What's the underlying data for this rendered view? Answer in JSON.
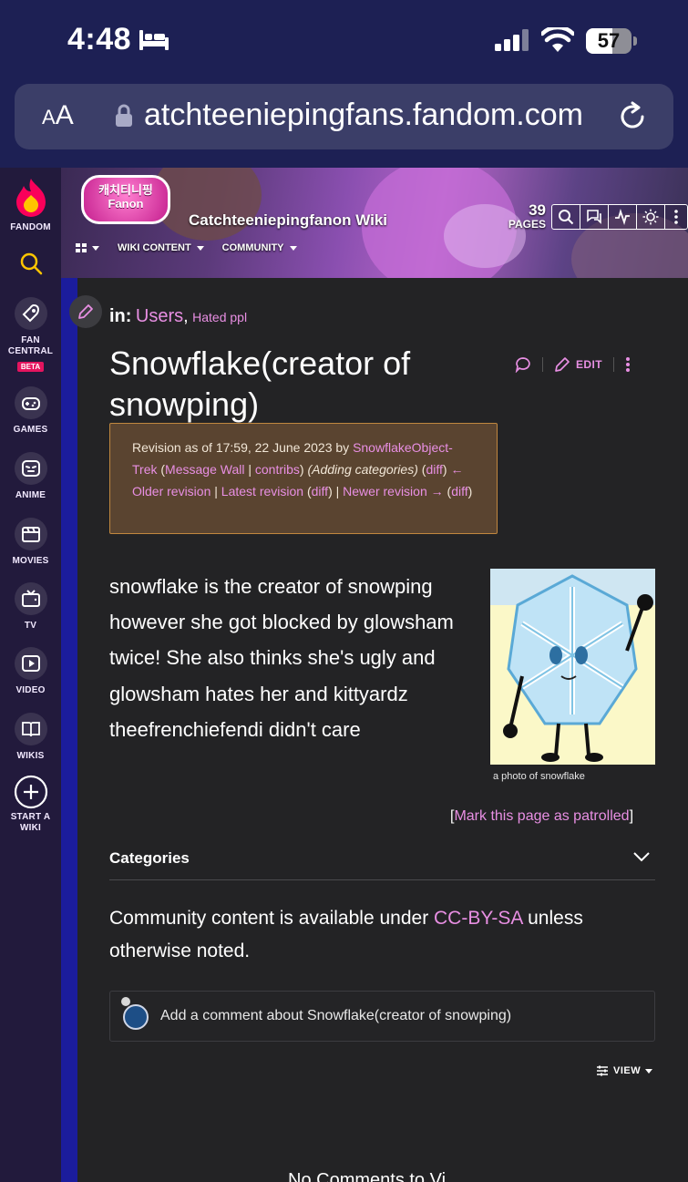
{
  "status_bar": {
    "time": "4:48",
    "battery": "57",
    "battery_level_percent": 57
  },
  "browser": {
    "aa_label_big": "A",
    "aa_label_small": "A",
    "url": "atchteeniepingfans.fandom.com"
  },
  "rail": {
    "logo_label": "FANDOM",
    "items": [
      {
        "label": "FAN CENTRAL",
        "badge": "BETA",
        "icon": "rocket-icon"
      },
      {
        "label": "GAMES",
        "icon": "gamepad-icon"
      },
      {
        "label": "ANIME",
        "icon": "anime-icon"
      },
      {
        "label": "MOVIES",
        "icon": "clapper-icon"
      },
      {
        "label": "TV",
        "icon": "tv-icon"
      },
      {
        "label": "VIDEO",
        "icon": "video-icon"
      },
      {
        "label": "WIKIS",
        "icon": "book-icon"
      },
      {
        "label": "START A WIKI",
        "icon": "plus-circle-icon"
      }
    ]
  },
  "wiki": {
    "logo_text": "캐치티니핑 Fanon",
    "name": "Catchteeniepingfanon Wiki",
    "pages_count": "39",
    "pages_label": "PAGES",
    "nav": [
      "WIKI CONTENT",
      "COMMUNITY"
    ]
  },
  "article": {
    "in_label": "in:",
    "categories": [
      "Users",
      "Hated ppl"
    ],
    "title": "Snowflake(creator of snowping)",
    "edit_label": "EDIT",
    "revision": {
      "prefix": "Revision as of 17:59, 22 June 2023 by ",
      "user": "SnowflakeObject-Trek",
      "message_wall": "Message Wall",
      "contribs": "contribs",
      "summary": "(Adding categories)",
      "diff": "diff",
      "older": "← Older revision",
      "latest": "Latest revision",
      "newer": "Newer revision →"
    },
    "body": "snowflake is the creator of snowping however she got blocked by glowsham twice! She also thinks she's ugly and glowsham hates her and kittyardz theefrenchiefendi didn't care",
    "image_caption": "a photo of snowflake",
    "patrol_link": "Mark this page as patrolled",
    "categories_header": "Categories",
    "license_prefix": "Community content is available under ",
    "license_link": "CC-BY-SA",
    "license_suffix": " unless otherwise noted.",
    "comment_placeholder": "Add a comment about Snowflake(creator of snowping)",
    "view_label": "VIEW",
    "cut_text": "No Comments to Vi..."
  },
  "colors": {
    "link": "#e88fe3",
    "rail_bg": "#221a3c",
    "stripe": "#1b1c9c",
    "page_bg": "#232325",
    "revision_bg": "#5a4430"
  }
}
